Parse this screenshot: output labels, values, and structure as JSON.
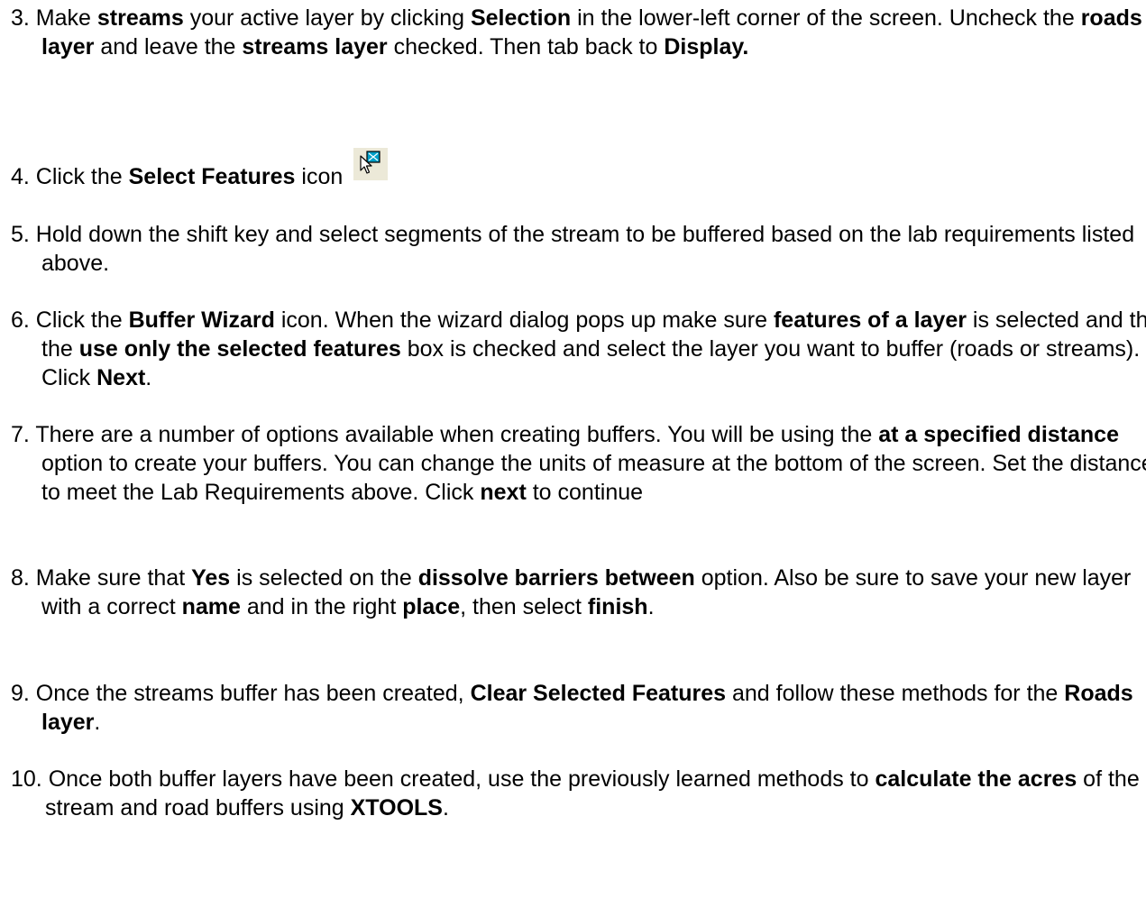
{
  "steps": [
    {
      "id": "3",
      "parts": [
        {
          "t": "3. Make "
        },
        {
          "b": "streams"
        },
        {
          "t": " your active layer by clicking "
        },
        {
          "b": "Selection"
        },
        {
          "t": " in the lower-left corner of the screen. Uncheck the "
        },
        {
          "b": "roads layer"
        },
        {
          "t": " and leave the "
        },
        {
          "b": "streams layer"
        },
        {
          "t": " checked. Then tab back to "
        },
        {
          "b": "Display."
        }
      ]
    },
    {
      "id": "4",
      "parts": [
        {
          "t": "4. Click the "
        },
        {
          "b": "Select Features"
        },
        {
          "t": " icon"
        }
      ],
      "icon": "select-features-icon"
    },
    {
      "id": "5",
      "parts": [
        {
          "t": "5. Hold down the shift key and select segments of the stream to be buffered based on the lab requirements listed above."
        }
      ]
    },
    {
      "id": "6",
      "parts": [
        {
          "t": "6. Click the "
        },
        {
          "b": "Buffer Wizard"
        },
        {
          "t": " icon. When the wizard dialog pops up make sure "
        },
        {
          "b": "features of a layer"
        },
        {
          "t": " is selected and that the "
        },
        {
          "b": "use only the selected features"
        },
        {
          "t": " box is checked and select the layer you want to buffer (roads or streams). Click "
        },
        {
          "b": "Next"
        },
        {
          "t": "."
        }
      ]
    },
    {
      "id": "7",
      "parts": [
        {
          "t": "7. There are a number of options available when creating buffers. You will be using the "
        },
        {
          "b": "at a specified distance"
        },
        {
          "t": " option to create your buffers. You can change the units of measure at the bottom of the screen. Set the distance to meet the Lab Requirements above. Click "
        },
        {
          "b": "next"
        },
        {
          "t": " to continue"
        }
      ]
    },
    {
      "id": "8",
      "parts": [
        {
          "t": "8. Make sure that "
        },
        {
          "b": "Yes"
        },
        {
          "t": " is selected on the "
        },
        {
          "b": "dissolve barriers between"
        },
        {
          "t": " option. Also be sure to save your new layer with a correct "
        },
        {
          "b": "name"
        },
        {
          "t": " and in the right "
        },
        {
          "b": "place"
        },
        {
          "t": ", then select "
        },
        {
          "b": "finish"
        },
        {
          "t": "."
        }
      ]
    },
    {
      "id": "9",
      "parts": [
        {
          "t": "9. Once the streams buffer has been created, "
        },
        {
          "b": "Clear Selected Features"
        },
        {
          "t": " and follow these methods for the "
        },
        {
          "b": "Roads layer"
        },
        {
          "t": "."
        }
      ]
    },
    {
      "id": "10",
      "parts": [
        {
          "t": "10. Once both buffer layers have been created, use the previously learned methods to "
        },
        {
          "b": "calculate the acres"
        },
        {
          "t": " of the stream and road buffers using "
        },
        {
          "b": "XTOOLS"
        },
        {
          "t": "."
        }
      ]
    }
  ],
  "colors": {
    "text": "#000000",
    "icon_bg": "#ece9d8",
    "icon_accent": "#00a0c8"
  }
}
